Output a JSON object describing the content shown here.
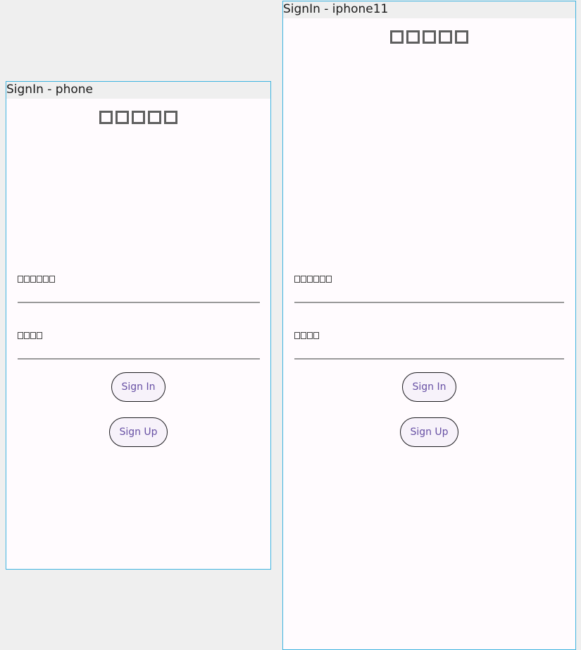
{
  "frames": [
    {
      "label": "SignIn - phone",
      "title_text": "□□□□□",
      "username_label": "□□□□□□",
      "password_label": "□□□□",
      "sign_in_label": "Sign In",
      "sign_up_label": "Sign Up"
    },
    {
      "label": "SignIn - iphone11",
      "title_text": "□□□□□",
      "username_label": "□□□□□□",
      "password_label": "□□□□",
      "sign_in_label": "Sign In",
      "sign_up_label": "Sign Up"
    }
  ],
  "colors": {
    "frame_border": "#3fb4e0",
    "frame_background": "#fffbfe",
    "canvas_background": "#efefef",
    "button_text": "#6750a4",
    "button_background": "#f7f2fa"
  }
}
